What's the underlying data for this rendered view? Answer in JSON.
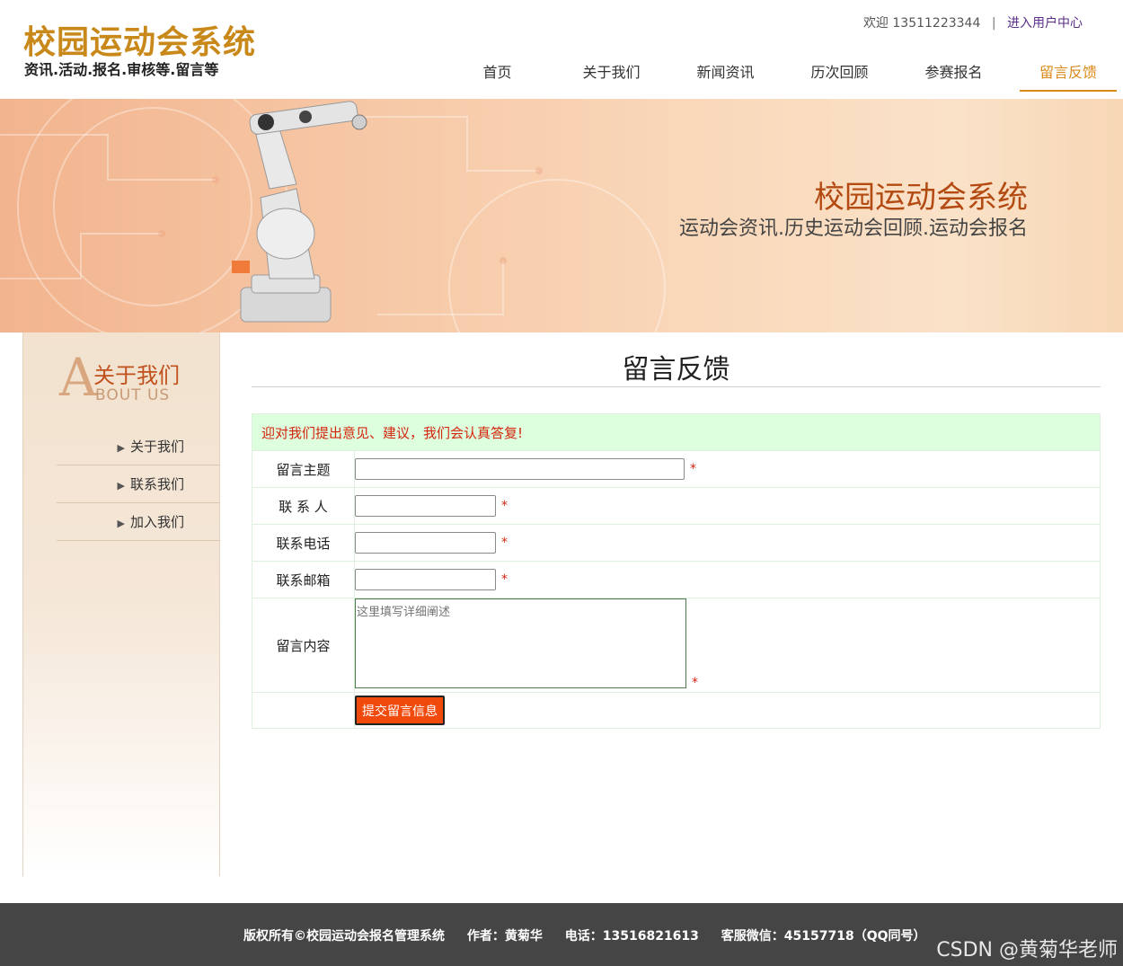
{
  "header": {
    "logo_title": "校园运动会系统",
    "logo_subtitle": "资讯.活动.报名.审核等.留言等",
    "welcome": "欢迎 13511223344",
    "separator": "|",
    "user_center": "进入用户中心",
    "nav": [
      {
        "label": "首页"
      },
      {
        "label": "关于我们"
      },
      {
        "label": "新闻资讯"
      },
      {
        "label": "历次回顾"
      },
      {
        "label": "参赛报名"
      },
      {
        "label": "留言反馈",
        "active": true
      }
    ],
    "accent_color": "#d98a1a"
  },
  "banner": {
    "title": "校园运动会系统",
    "subtitle": "运动会资讯.历史运动会回顾.运动会报名"
  },
  "sidebar": {
    "big_letter": "A",
    "title_cn": "关于我们",
    "title_en": "BOUT US",
    "items": [
      {
        "label": "关于我们",
        "icon": "arrow-right-icon"
      },
      {
        "label": "联系我们",
        "icon": "arrow-right-icon"
      },
      {
        "label": "加入我们",
        "icon": "arrow-right-icon"
      }
    ]
  },
  "main": {
    "title": "留言反馈",
    "notice": "迎对我们提出意见、建议，我们会认真答复!",
    "form": {
      "subject_label": "留言主题",
      "contact_label": "联 系 人",
      "phone_label": "联系电话",
      "email_label": "联系邮箱",
      "content_label": "留言内容",
      "content_placeholder": "这里填写详细阐述",
      "required_mark": "*",
      "submit_label": "提交留言信息"
    }
  },
  "footer": {
    "copyright": "版权所有©校园运动会报名管理系统",
    "author": "作者：黄菊华",
    "phone": "电话：13516821613",
    "wechat": "客服微信：45157718（QQ同号）"
  },
  "watermark": "CSDN @黄菊华老师"
}
